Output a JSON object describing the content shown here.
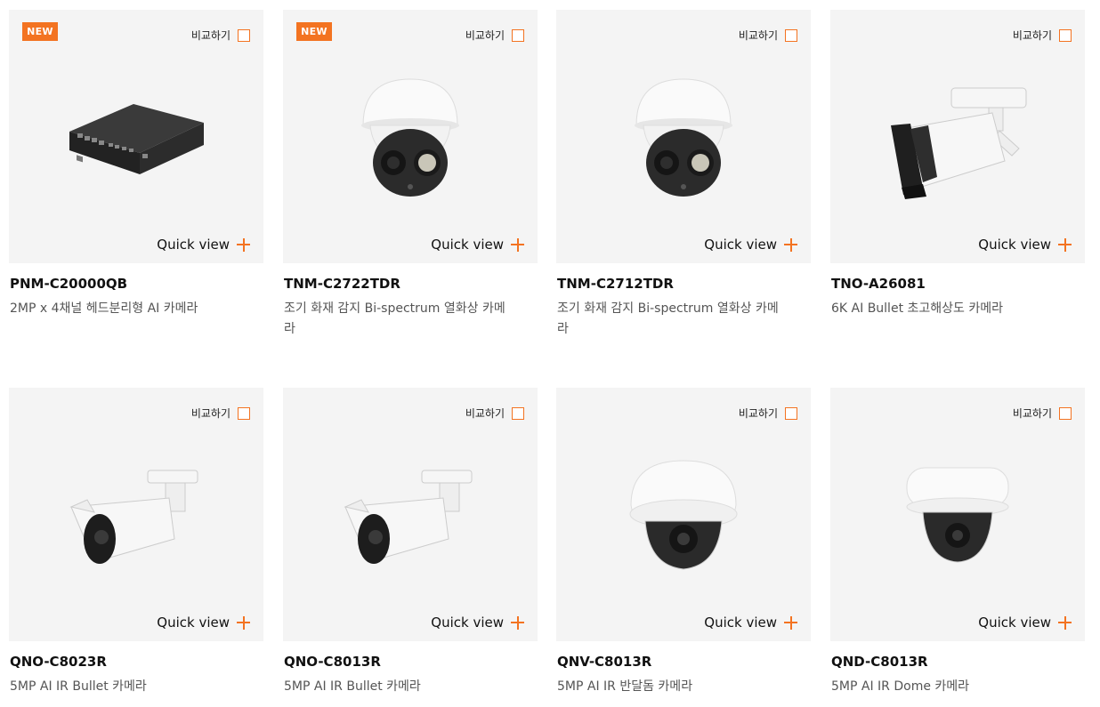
{
  "accent_color": "#f37321",
  "products": [
    {
      "badge": "NEW",
      "compare_label": "비교하기",
      "quick_view_label": "Quick view",
      "name": "PNM-C20000QB",
      "description": "2MP x 4채널 헤드분리형 AI 카메라",
      "icon": "multi-channel-box"
    },
    {
      "badge": "NEW",
      "compare_label": "비교하기",
      "quick_view_label": "Quick view",
      "name": "TNM-C2722TDR",
      "description": "조기 화재 감지 Bi-spectrum 열화상 카메라",
      "icon": "thermal-turret"
    },
    {
      "badge": "",
      "compare_label": "비교하기",
      "quick_view_label": "Quick view",
      "name": "TNM-C2712TDR",
      "description": "조기 화재 감지 Bi-spectrum 열화상 카메라",
      "icon": "thermal-turret"
    },
    {
      "badge": "",
      "compare_label": "비교하기",
      "quick_view_label": "Quick view",
      "name": "TNO-A26081",
      "description": "6K AI Bullet 초고해상도 카메라",
      "icon": "large-bullet"
    },
    {
      "badge": "",
      "compare_label": "비교하기",
      "quick_view_label": "Quick view",
      "name": "QNO-C8023R",
      "description": "5MP AI IR Bullet 카메라",
      "icon": "bullet"
    },
    {
      "badge": "",
      "compare_label": "비교하기",
      "quick_view_label": "Quick view",
      "name": "QNO-C8013R",
      "description": "5MP AI IR Bullet 카메라",
      "icon": "bullet"
    },
    {
      "badge": "",
      "compare_label": "비교하기",
      "quick_view_label": "Quick view",
      "name": "QNV-C8013R",
      "description": "5MP AI IR 반달돔 카메라",
      "icon": "vandal-dome"
    },
    {
      "badge": "",
      "compare_label": "비교하기",
      "quick_view_label": "Quick view",
      "name": "QND-C8013R",
      "description": "5MP AI IR Dome 카메라",
      "icon": "dome"
    }
  ]
}
